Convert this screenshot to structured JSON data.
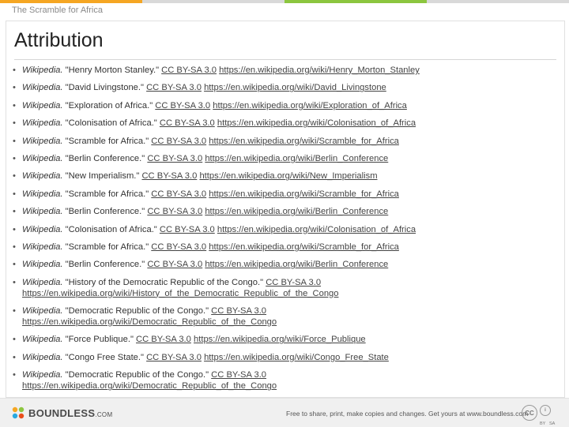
{
  "header": {
    "section": "The Scramble for Africa",
    "stripe_colors": [
      "#f5a623",
      "#d9d9d9",
      "#8cc63f",
      "#d9d9d9"
    ]
  },
  "slide": {
    "title": "Attribution"
  },
  "refs": [
    {
      "source": "Wikipedia.",
      "text": " \"Henry Morton Stanley.\" ",
      "license": "CC BY-SA 3.0",
      "url": "https://en.wikipedia.org/wiki/Henry_Morton_Stanley"
    },
    {
      "source": "Wikipedia.",
      "text": " \"David Livingstone.\" ",
      "license": "CC BY-SA 3.0",
      "url": "https://en.wikipedia.org/wiki/David_Livingstone"
    },
    {
      "source": "Wikipedia.",
      "text": " \"Exploration of Africa.\" ",
      "license": "CC BY-SA 3.0",
      "url": "https://en.wikipedia.org/wiki/Exploration_of_Africa"
    },
    {
      "source": "Wikipedia.",
      "text": " \"Colonisation of Africa.\" ",
      "license": "CC BY-SA 3.0",
      "url": "https://en.wikipedia.org/wiki/Colonisation_of_Africa"
    },
    {
      "source": "Wikipedia.",
      "text": " \"Scramble for Africa.\" ",
      "license": "CC BY-SA 3.0",
      "url": "https://en.wikipedia.org/wiki/Scramble_for_Africa"
    },
    {
      "source": "Wikipedia.",
      "text": " \"Berlin Conference.\" ",
      "license": "CC BY-SA 3.0",
      "url": "https://en.wikipedia.org/wiki/Berlin_Conference"
    },
    {
      "source": "Wikipedia.",
      "text": " \"New Imperialism.\" ",
      "license": "CC BY-SA 3.0",
      "url": "https://en.wikipedia.org/wiki/New_Imperialism"
    },
    {
      "source": "Wikipedia.",
      "text": " \"Scramble for Africa.\" ",
      "license": "CC BY-SA 3.0",
      "url": "https://en.wikipedia.org/wiki/Scramble_for_Africa"
    },
    {
      "source": "Wikipedia.",
      "text": " \"Berlin Conference.\" ",
      "license": "CC BY-SA 3.0",
      "url": "https://en.wikipedia.org/wiki/Berlin_Conference"
    },
    {
      "source": "Wikipedia.",
      "text": " \"Colonisation of Africa.\" ",
      "license": "CC BY-SA 3.0",
      "url": "https://en.wikipedia.org/wiki/Colonisation_of_Africa"
    },
    {
      "source": "Wikipedia.",
      "text": " \"Scramble for Africa.\" ",
      "license": "CC BY-SA 3.0",
      "url": "https://en.wikipedia.org/wiki/Scramble_for_Africa"
    },
    {
      "source": "Wikipedia.",
      "text": " \"Berlin Conference.\" ",
      "license": "CC BY-SA 3.0",
      "url": "https://en.wikipedia.org/wiki/Berlin_Conference"
    },
    {
      "source": "Wikipedia.",
      "text": " \"History of the Democratic Republic of the Congo.\" ",
      "license": "CC BY-SA 3.0",
      "url": "https://en.wikipedia.org/wiki/History_of_the_Democratic_Republic_of_the_Congo"
    },
    {
      "source": "Wikipedia.",
      "text": " \"Democratic Republic of the Congo.\" ",
      "license": "CC BY-SA 3.0",
      "url": "https://en.wikipedia.org/wiki/Democratic_Republic_of_the_Congo"
    },
    {
      "source": "Wikipedia.",
      "text": " \"Force Publique.\" ",
      "license": "CC BY-SA 3.0",
      "url": "https://en.wikipedia.org/wiki/Force_Publique"
    },
    {
      "source": "Wikipedia.",
      "text": " \"Congo Free State.\" ",
      "license": "CC BY-SA 3.0",
      "url": "https://en.wikipedia.org/wiki/Congo_Free_State"
    },
    {
      "source": "Wikipedia.",
      "text": " \"Democratic Republic of the Congo.\" ",
      "license": "CC BY-SA 3.0",
      "url": "https://en.wikipedia.org/wiki/Democratic_Republic_of_the_Congo"
    }
  ],
  "footer": {
    "brand": "BOUNDLESS",
    "brand_suffix": ".COM",
    "note": "Free to share, print, make copies and changes. Get yours at www.boundless.com",
    "cc_label": "CC",
    "by_label": "BY",
    "sa_label": "SA",
    "logo_icon": "boundless-logo-icon",
    "brand_color": "#f5a623"
  }
}
